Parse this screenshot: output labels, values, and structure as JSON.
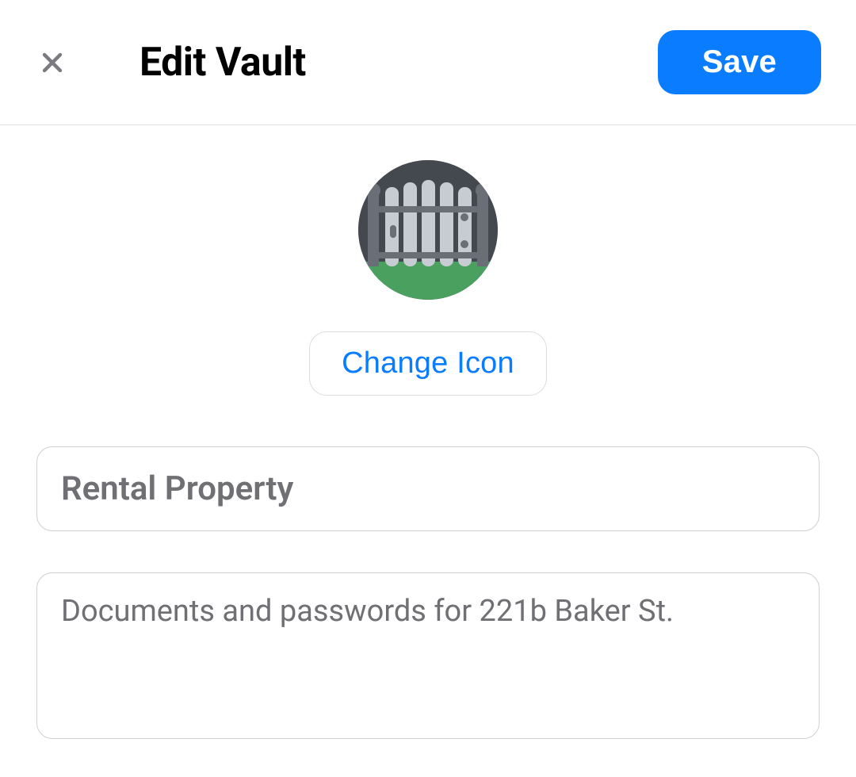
{
  "header": {
    "title": "Edit Vault",
    "save_label": "Save"
  },
  "icon": {
    "name": "gate-icon",
    "change_label": "Change Icon"
  },
  "form": {
    "name_value": "Rental Property",
    "description_value": "Documents and passwords for 221b Baker St."
  },
  "colors": {
    "accent": "#0a7cff"
  }
}
